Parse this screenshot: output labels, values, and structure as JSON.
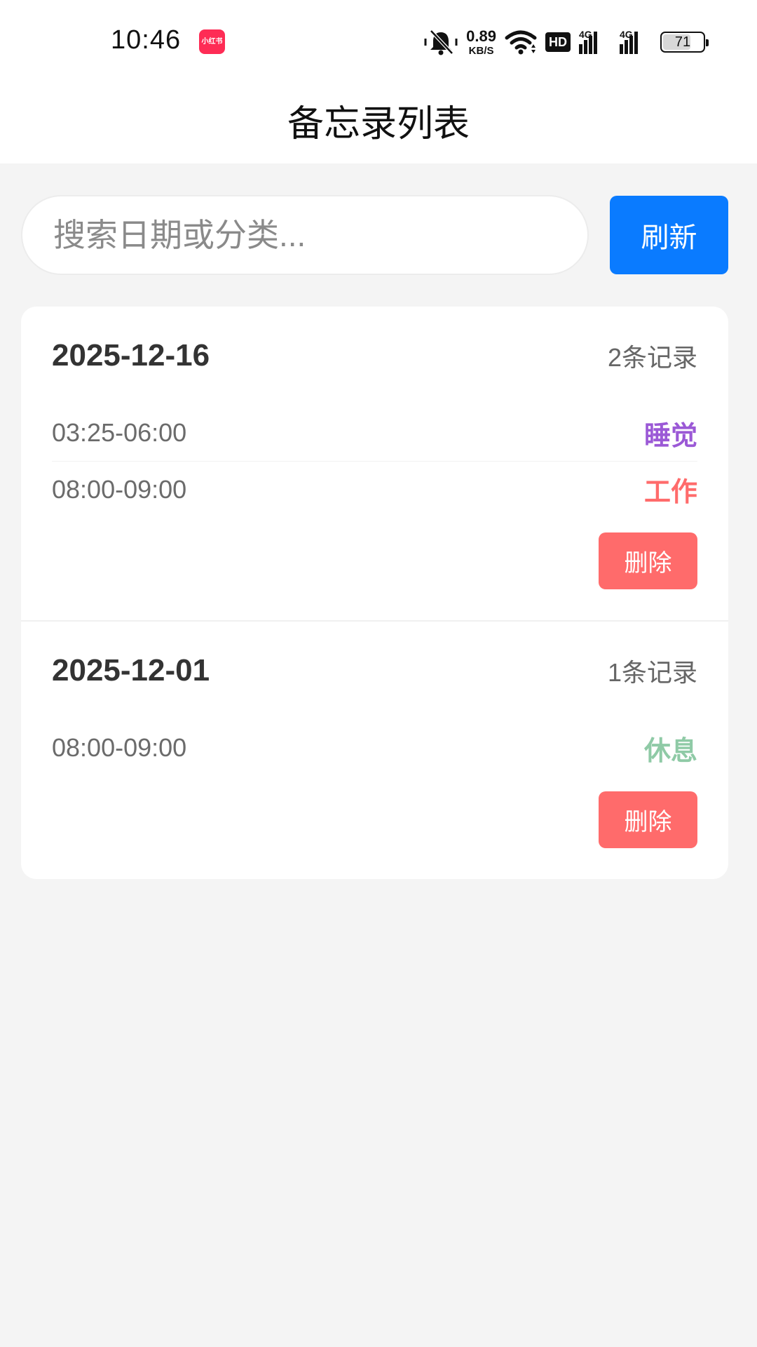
{
  "status_bar": {
    "time": "10:46",
    "app_badge": "小红书",
    "net_speed_value": "0.89",
    "net_speed_unit": "KB/S",
    "hd_label": "HD",
    "signal1_label": "4G",
    "signal2_label": "4G",
    "battery": "71",
    "battery_level": 0.71
  },
  "header": {
    "title": "备忘录列表"
  },
  "search": {
    "placeholder": "搜索日期或分类...",
    "value": ""
  },
  "refresh_label": "刷新",
  "groups": [
    {
      "date": "2025-12-16",
      "count": "2条记录",
      "records": [
        {
          "time": "03:25-06:00",
          "category": "睡觉",
          "color": "#9b59d6"
        },
        {
          "time": "08:00-09:00",
          "category": "工作",
          "color": "#ff6b6b"
        }
      ],
      "delete_label": "删除"
    },
    {
      "date": "2025-12-01",
      "count": "1条记录",
      "records": [
        {
          "time": "08:00-09:00",
          "category": "休息",
          "color": "#8fcaa6"
        }
      ],
      "delete_label": "删除"
    }
  ]
}
